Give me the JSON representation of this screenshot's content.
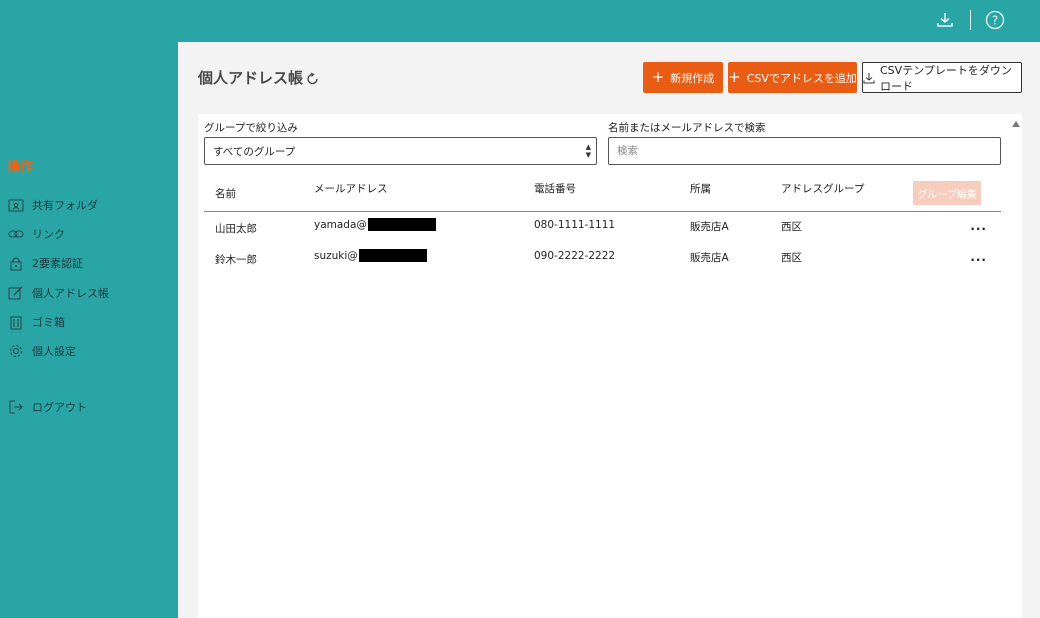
{
  "header": {
    "icons": [
      "download-icon",
      "help-icon"
    ]
  },
  "sidebar": {
    "heading": "操作",
    "items": [
      {
        "label": "共有フォルダ",
        "icon": "shared-folder-icon"
      },
      {
        "label": "リンク",
        "icon": "link-icon"
      },
      {
        "label": "2要素認証",
        "icon": "lock-icon"
      },
      {
        "label": "個人アドレス帳",
        "icon": "edit-icon"
      },
      {
        "label": "ゴミ箱",
        "icon": "trash-icon"
      },
      {
        "label": "個人設定",
        "icon": "gear-icon"
      },
      {
        "label": "ログアウト",
        "icon": "logout-icon"
      }
    ]
  },
  "main": {
    "title": "個人アドレス帳",
    "buttons": {
      "new": "新規作成",
      "csv_add": "CSVでアドレスを追加",
      "csv_template": "CSVテンプレートをダウンロード"
    },
    "filter": {
      "group_label": "グループで絞り込み",
      "group_selected": "すべてのグループ",
      "search_label": "名前またはメールアドレスで検索",
      "search_placeholder": "検索",
      "search_value": ""
    },
    "table": {
      "headers": [
        "名前",
        "メールアドレス",
        "電話番号",
        "所属",
        "アドレスグループ"
      ],
      "group_edit": "グループ編集",
      "rows": [
        {
          "name": "山田太郎",
          "email": "yamada@",
          "phone": "080-1111-1111",
          "affiliation": "販売店A",
          "group": "西区",
          "more": "..."
        },
        {
          "name": "鈴木一郎",
          "email": "suzuki@",
          "phone": "090-2222-2222",
          "affiliation": "販売店A",
          "group": "西区",
          "more": "..."
        }
      ]
    }
  },
  "colors": {
    "teal": "#2aa5a6",
    "orange": "#e85d13",
    "disabled_orange": "#f7cdbd",
    "panel_bg": "#f3f3f3"
  }
}
